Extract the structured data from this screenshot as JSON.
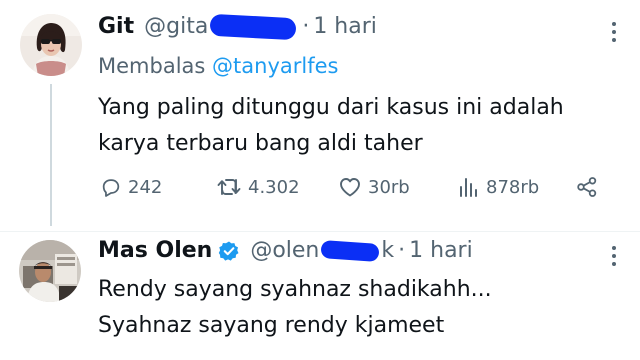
{
  "tweets": [
    {
      "name": "Git",
      "handle_visible": "@gita",
      "separator": "·",
      "time": "1 hari",
      "reply_prefix": "Membalas",
      "reply_mention": "@tanyarlfes",
      "text_lines": [
        "Yang paling ditunggu dari kasus ini adalah",
        "karya terbaru bang aldi taher"
      ],
      "stats": {
        "replies": "242",
        "retweets": "4.302",
        "likes": "30rb",
        "views": "878rb"
      }
    },
    {
      "name": "Mas Olen",
      "verified": true,
      "handle_visible": "@olen",
      "handle_suffix": "k",
      "separator": "·",
      "time": "1 hari",
      "text_lines": [
        "Rendy sayang syahnaz shadikahh...",
        "Syahnaz sayang rendy kjameet"
      ]
    }
  ],
  "colors": {
    "primary_text": "#0f1419",
    "secondary_text": "#536471",
    "mention": "#1d9bf0",
    "verified_badge": "#1d9bf0",
    "redaction": "#0b2ff5"
  },
  "icons": {
    "reply": "speech-bubble-icon",
    "retweet": "retweet-arrows-icon",
    "like": "heart-icon",
    "views": "bar-chart-icon",
    "share": "share-nodes-icon",
    "more": "vertical-dots-icon"
  }
}
